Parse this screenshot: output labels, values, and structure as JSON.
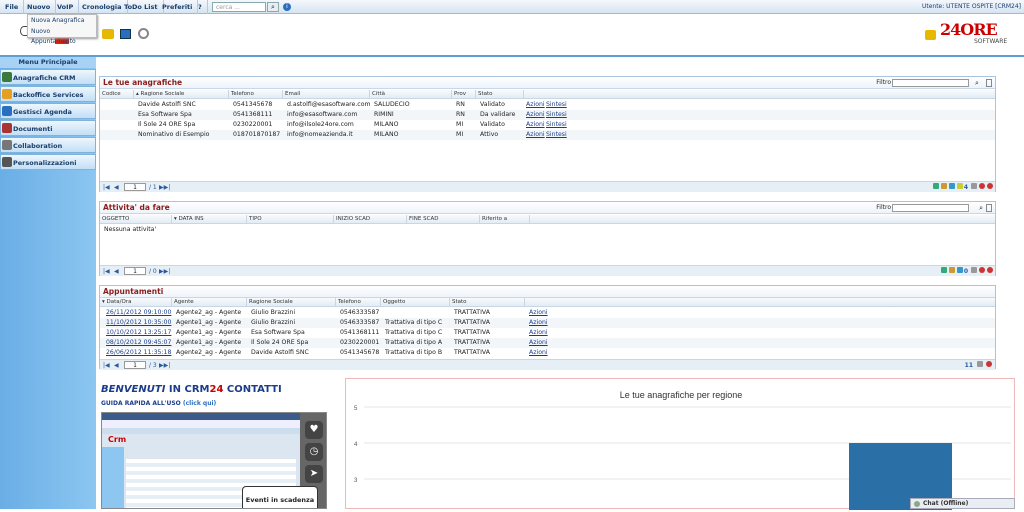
{
  "menubar": {
    "items": [
      "File",
      "Nuovo",
      "VoIP",
      "Cronologia",
      "ToDo List",
      "Preferiti",
      "?"
    ],
    "search_placeholder": "cerca ...",
    "user": "Utente: UTENTE OSPITE [CRM24]"
  },
  "dropdown": [
    "Nuova Anagrafica",
    "Nuovo Appuntamento"
  ],
  "logo": {
    "brand": "24ORE",
    "sub": "SOFTWARE"
  },
  "sidebar": {
    "title": "Menu Principale",
    "items": [
      "Anagrafiche CRM",
      "Backoffice Services",
      "Gestisci Agenda",
      "Documenti",
      "Collaboration",
      "Personalizzazioni"
    ]
  },
  "anagrafiche": {
    "title": "Le tue anagrafiche",
    "filter_label": "Filtro",
    "columns": [
      "Codice",
      "Ragione Sociale",
      "Telefono",
      "Email",
      "Città",
      "Prov",
      "Stato"
    ],
    "rows": [
      {
        "ragione": "Davide Astolfi SNC",
        "tel": "0541345678",
        "email": "d.astolfi@esasoftware.com",
        "citta": "SALUDECIO",
        "prov": "RN",
        "stato": "Validato"
      },
      {
        "ragione": "Esa Software Spa",
        "tel": "0541368111",
        "email": "info@esasoftware.com",
        "citta": "RIMINI",
        "prov": "RN",
        "stato": "Da validare"
      },
      {
        "ragione": "Il Sole 24 ORE Spa",
        "tel": "0230220001",
        "email": "info@ilsole24ore.com",
        "citta": "MILANO",
        "prov": "MI",
        "stato": "Validato"
      },
      {
        "ragione": "Nominativo di Esempio",
        "tel": "018701870187",
        "email": "info@nomeazienda.it",
        "citta": "MILANO",
        "prov": "MI",
        "stato": "Attivo"
      }
    ],
    "azioni": "Azioni",
    "sintesi": "Sintesi",
    "page": "1",
    "of": "/ 1",
    "count": "4"
  },
  "attivita": {
    "title": "Attivita' da fare",
    "filter_label": "Filtro",
    "columns": [
      "OGGETTO",
      "DATA INS",
      "TIPO",
      "INIZIO SCAD",
      "FINE SCAD",
      "Riferito a"
    ],
    "empty": "Nessuna attivita'",
    "page": "1",
    "of": "/ 0",
    "count": "0"
  },
  "appuntamenti": {
    "title": "Appuntamenti",
    "columns": [
      "Data/Ora",
      "Agente",
      "Ragione Sociale",
      "Telefono",
      "Oggetto",
      "Stato"
    ],
    "rows": [
      {
        "data": "26/11/2012 09:10:00",
        "agente": "Agente2_ag - Agente",
        "ragione": "Giulio Brazzini",
        "tel": "0546333587",
        "oggetto": "",
        "stato": "TRATTATIVA"
      },
      {
        "data": "11/10/2012 10:35:00",
        "agente": "Agente1_ag - Agente",
        "ragione": "Giulio Brazzini",
        "tel": "0546333587",
        "oggetto": "Trattativa di tipo C",
        "stato": "TRATTATIVA"
      },
      {
        "data": "10/10/2012 13:25:17",
        "agente": "Agente1_ag - Agente",
        "ragione": "Esa Software Spa",
        "tel": "0541368111",
        "oggetto": "Trattativa di tipo C",
        "stato": "TRATTATIVA"
      },
      {
        "data": "08/10/2012 09:45:07",
        "agente": "Agente1_ag - Agente",
        "ragione": "Il Sole 24 ORE Spa",
        "tel": "0230220001",
        "oggetto": "Trattativa di tipo A",
        "stato": "TRATTATIVA"
      },
      {
        "data": "26/06/2012 11:35:18",
        "agente": "Agente2_ag - Agente",
        "ragione": "Davide Astolfi SNC",
        "tel": "0541345678",
        "oggetto": "Trattativa di tipo B",
        "stato": "TRATTATIVA"
      }
    ],
    "azioni": "Azioni",
    "page": "1",
    "of": "/ 3",
    "count": "11"
  },
  "welcome": {
    "prefix": "BENVENUTI",
    "in": "IN CRM",
    "num": "24",
    "suffix": "CONTATTI",
    "guide": "GUIDA RAPIDA ALL'USO",
    "click": "(click qui)",
    "bubble": "Eventi in scadenza"
  },
  "chart_data": {
    "type": "bar",
    "title": "Le tue anagrafiche per regione",
    "yticks": [
      5,
      4,
      3
    ],
    "ylim": [
      3,
      5
    ],
    "series": [
      {
        "values": [
          4
        ]
      }
    ]
  },
  "chat": "Chat (Offline)",
  "colors": {
    "accent": "#1a3d8b",
    "title_red": "#8a1c1c",
    "bar": "#2a6fa5"
  }
}
